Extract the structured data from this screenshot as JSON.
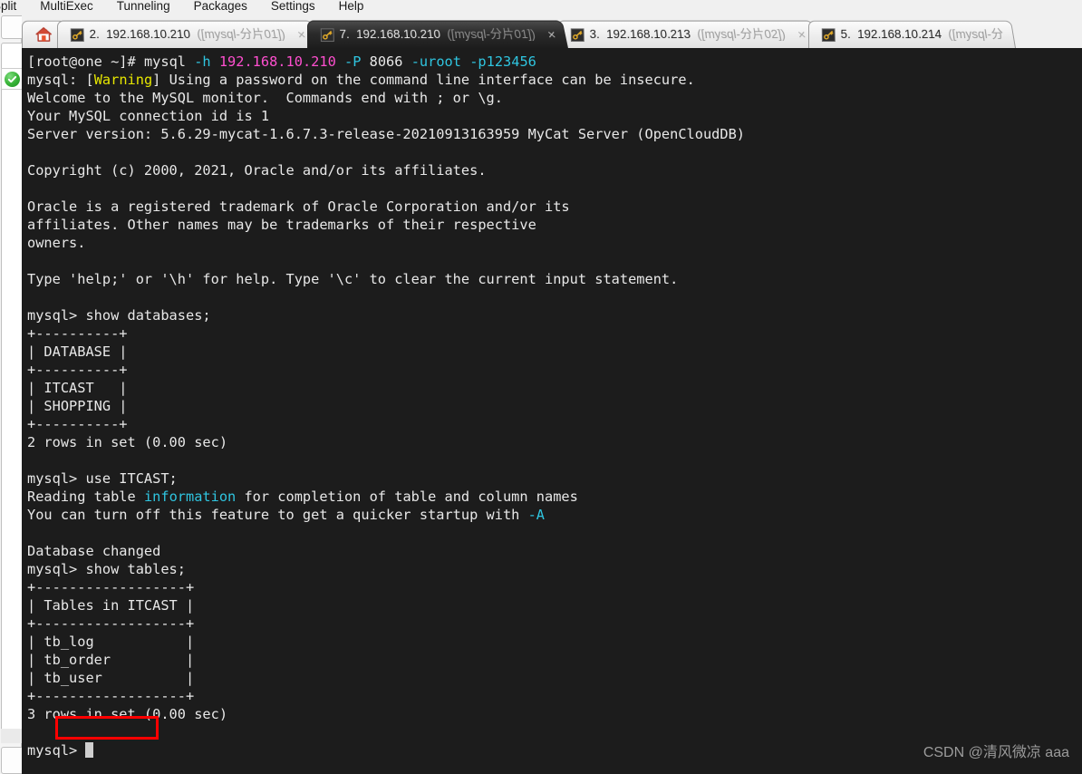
{
  "menu": {
    "items": [
      "Split",
      "MultiExec",
      "Tunneling",
      "Packages",
      "Settings",
      "Help"
    ]
  },
  "tabs": {
    "home_tooltip": "Home",
    "items": [
      {
        "number": "2.",
        "host": "192.168.10.210",
        "session": "([mysql-分片01])",
        "close": "×",
        "active": false
      },
      {
        "number": "7.",
        "host": "192.168.10.210",
        "session": "([mysql-分片01])",
        "close": "×",
        "active": true
      },
      {
        "number": "3.",
        "host": "192.168.10.213",
        "session": "([mysql-分片02])",
        "close": "×",
        "active": false
      },
      {
        "number": "5.",
        "host": "192.168.10.214",
        "session": "([mysql-分",
        "close": "×",
        "active": false
      }
    ]
  },
  "sidebar": {
    "status_icon": "green-check-icon"
  },
  "terminal": {
    "prompt_host": "[root@one ~]#",
    "command": " mysql ",
    "flag_h": "-h",
    "ip": "192.168.10.210",
    "flag_P": "-P",
    "port": "8066",
    "flag_u": "-uroot",
    "flag_p": "-p123456",
    "line_warn_prefix": "mysql: [",
    "line_warn_word": "Warning",
    "line_warn_suffix": "] Using a password on the command line interface can be insecure.",
    "line_welcome": "Welcome to the MySQL monitor.  Commands end with ; or \\g.",
    "line_connid": "Your MySQL connection id is 1",
    "line_server": "Server version: 5.6.29-mycat-1.6.7.3-release-20210913163959 MyCat Server (OpenCloudDB)",
    "line_blank": "",
    "line_copyright": "Copyright (c) 2000, 2021, Oracle and/or its affiliates.",
    "line_trademark1": "Oracle is a registered trademark of Oracle Corporation and/or its",
    "line_trademark2": "affiliates. Other names may be trademarks of their respective",
    "line_trademark3": "owners.",
    "line_help": "Type 'help;' or '\\h' for help. Type '\\c' to clear the current input statement.",
    "cmd_show_databases": "mysql> show databases;",
    "db_table": [
      "+----------+",
      "| DATABASE |",
      "+----------+",
      "| ITCAST   |",
      "| SHOPPING |",
      "+----------+"
    ],
    "db_rows": "2 rows in set (0.00 sec)",
    "cmd_use": "mysql> use ITCAST;",
    "reading_prefix": "Reading table ",
    "reading_word": "information",
    "reading_suffix": " for completion of table and column names",
    "turnoff_prefix": "You can turn off this feature to get a quicker startup with ",
    "turnoff_flag": "-A",
    "db_changed": "Database changed",
    "cmd_show_tables": "mysql> show tables;",
    "tb_table": [
      "+------------------+",
      "| Tables in ITCAST |",
      "+------------------+",
      "| tb_log           |",
      "| tb_order         |",
      "| tb_user          |",
      "+------------------+"
    ],
    "tb_rows": "3 rows in set (0.00 sec)",
    "final_prompt": "mysql> "
  },
  "annotation": {
    "highlight_target": "tb_user",
    "color": "#ff0000"
  },
  "watermark": {
    "text": "CSDN @清风微凉 aaa"
  }
}
